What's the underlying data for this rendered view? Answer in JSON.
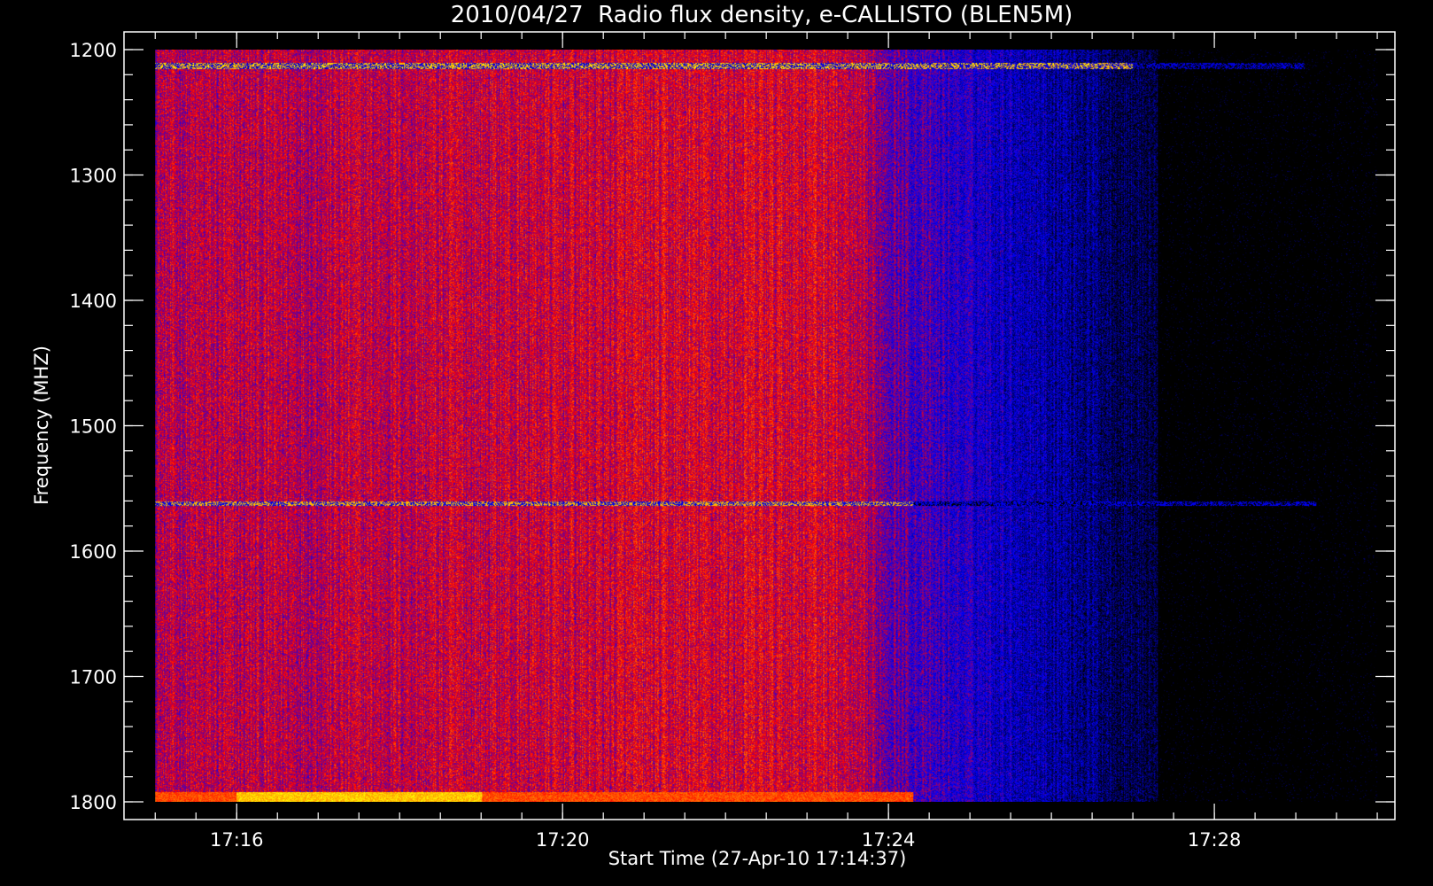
{
  "chart_data": {
    "type": "heatmap",
    "title": "2010/04/27  Radio flux density, e-CALLISTO (BLEN5M)",
    "xlabel": "Start Time (27-Apr-10 17:14:37)",
    "ylabel": "Frequency (MHZ)",
    "x_unit": "UT time",
    "xlim": [
      "17:14:37",
      "17:30:13"
    ],
    "data_time_range": [
      "17:15:00",
      "17:30:00"
    ],
    "ylim": [
      1200,
      1800
    ],
    "y_axis_inverted": true,
    "x_ticks": [
      "17:16",
      "17:20",
      "17:24",
      "17:28"
    ],
    "y_ticks": [
      1200,
      1300,
      1400,
      1500,
      1600,
      1700,
      1800
    ],
    "colormap": [
      "#000000",
      "#0000ff",
      "#ff0000",
      "#ffff00"
    ],
    "grid": false,
    "features": [
      {
        "type": "intensity_decay",
        "description": "red emission transitioning to blue",
        "time_range": [
          "17:23",
          "17:27"
        ]
      },
      {
        "type": "horizontal_band",
        "frequency": 1213,
        "time_range": [
          "17:15",
          "17:30"
        ]
      },
      {
        "type": "horizontal_band",
        "frequency": 1562,
        "time_range": [
          "17:15",
          "17:30"
        ]
      },
      {
        "type": "bright_emission",
        "frequency": 1798,
        "time_range": [
          "17:16",
          "17:19"
        ]
      }
    ]
  }
}
